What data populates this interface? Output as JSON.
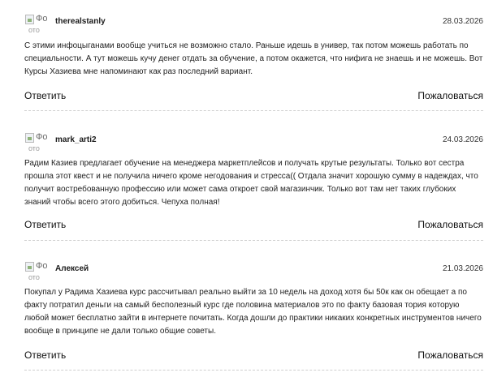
{
  "reviews": [
    {
      "avatar_alt": "Фо",
      "avatar_alt2": "ото",
      "author": "therealstanly",
      "date": "28.03.2026",
      "text": "С этими инфоцыганами вообще учиться не возможно стало. Раньше идешь в универ, так потом можешь работать по специальности. А тут можешь кучу денег отдать за обучение, а потом окажется, что нифига не знаешь и не можешь. Вот Курсы Хазиева мне напоминают как раз последний вариант.",
      "reply_label": "Ответить",
      "report_label": "Пожаловаться"
    },
    {
      "avatar_alt": "Фо",
      "avatar_alt2": "ото",
      "author": "mark_arti2",
      "date": "24.03.2026",
      "text": "Радим Казиев предлагает обучение на менеджера маркетплейсов и получать крутые результаты. Только вот сестра прошла этот квест и не получила ничего кроме негодования и стресса(( Отдала значит хорошую сумму в надеждах, что получит востребованную профессию или может сама откроет свой магазинчик. Только вот там нет таких глубоких знаний чтобы всего этого добиться. Чепуха полная!",
      "reply_label": "Ответить",
      "report_label": "Пожаловаться"
    },
    {
      "avatar_alt": "Фо",
      "avatar_alt2": "ото",
      "author": "Алексей",
      "date": "21.03.2026",
      "text": "Покупал у Радима Хазиева курс рассчитывал реально выйти за 10 недель на доход хотя бы 50к как он обещает а по факту потратил деньги на самый бесполезный курс где половина материалов это по факту базовая тория которую любой может бесплатно зайти в интернете почитать. Когда дошли до практики никаких конкретных инструментов ничего вообще в принципе не дали только общие советы.",
      "reply_label": "Ответить",
      "report_label": "Пожаловаться"
    }
  ]
}
